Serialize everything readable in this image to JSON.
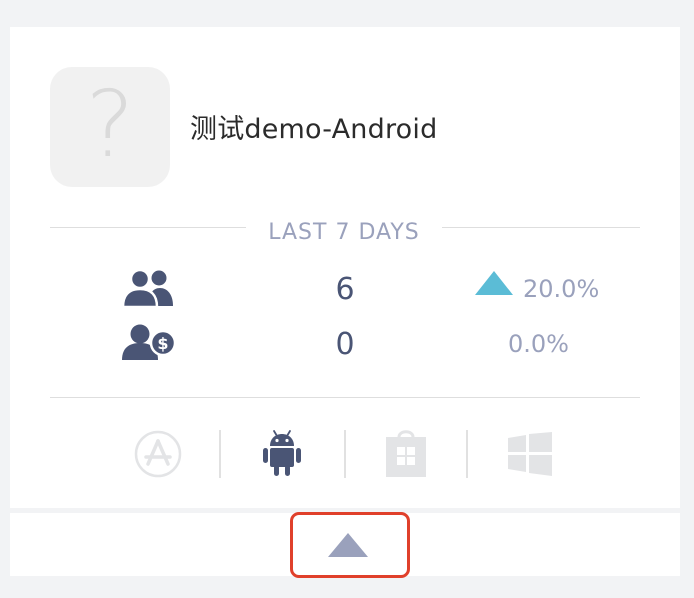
{
  "app": {
    "name": "测试demo-Android",
    "icon_glyph": "?"
  },
  "section_label": "LAST 7 DAYS",
  "stats": [
    {
      "icon": "users-icon",
      "value": "6",
      "trend": "up",
      "change": "20.0%"
    },
    {
      "icon": "paying-users-icon",
      "value": "0",
      "trend": "none",
      "change": "0.0%"
    }
  ],
  "platforms": [
    {
      "name": "app-store-icon",
      "active": false
    },
    {
      "name": "android-icon",
      "active": true
    },
    {
      "name": "windows-store-icon",
      "active": false
    },
    {
      "name": "windows-icon",
      "active": false
    }
  ],
  "colors": {
    "accent_up": "#5bbcd6",
    "icon_dark": "#4a5575",
    "muted": "#9aa1bc",
    "toggle_highlight": "#e0402b"
  },
  "footer": {
    "toggle_icon": "chevron-up-icon"
  }
}
